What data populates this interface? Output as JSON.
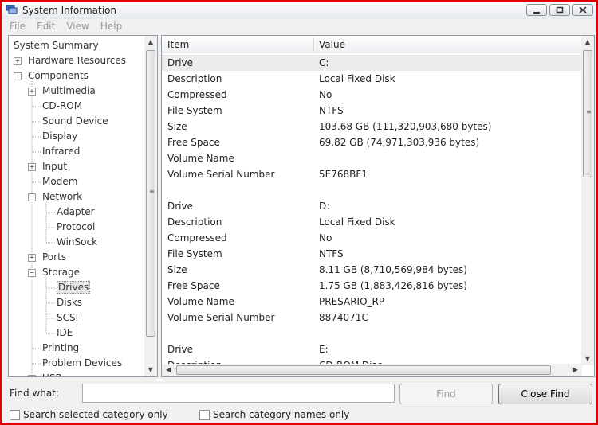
{
  "window": {
    "title": "System Information",
    "icon": "system-information-icon"
  },
  "window_controls": [
    "minimize-icon",
    "restore-icon",
    "close-icon"
  ],
  "menu": [
    "File",
    "Edit",
    "View",
    "Help"
  ],
  "tree": [
    {
      "label": "System Summary",
      "level": 0,
      "expander": "none"
    },
    {
      "label": "Hardware Resources",
      "level": 0,
      "expander": "plus"
    },
    {
      "label": "Components",
      "level": 0,
      "expander": "minus"
    },
    {
      "label": "Multimedia",
      "level": 1,
      "expander": "plus"
    },
    {
      "label": "CD-ROM",
      "level": 1,
      "expander": "none"
    },
    {
      "label": "Sound Device",
      "level": 1,
      "expander": "none"
    },
    {
      "label": "Display",
      "level": 1,
      "expander": "none"
    },
    {
      "label": "Infrared",
      "level": 1,
      "expander": "none"
    },
    {
      "label": "Input",
      "level": 1,
      "expander": "plus"
    },
    {
      "label": "Modem",
      "level": 1,
      "expander": "none"
    },
    {
      "label": "Network",
      "level": 1,
      "expander": "minus"
    },
    {
      "label": "Adapter",
      "level": 2,
      "expander": "none"
    },
    {
      "label": "Protocol",
      "level": 2,
      "expander": "none"
    },
    {
      "label": "WinSock",
      "level": 2,
      "expander": "none"
    },
    {
      "label": "Ports",
      "level": 1,
      "expander": "plus"
    },
    {
      "label": "Storage",
      "level": 1,
      "expander": "minus"
    },
    {
      "label": "Drives",
      "level": 2,
      "expander": "none",
      "selected": true
    },
    {
      "label": "Disks",
      "level": 2,
      "expander": "none"
    },
    {
      "label": "SCSI",
      "level": 2,
      "expander": "none"
    },
    {
      "label": "IDE",
      "level": 2,
      "expander": "none"
    },
    {
      "label": "Printing",
      "level": 1,
      "expander": "none"
    },
    {
      "label": "Problem Devices",
      "level": 1,
      "expander": "none"
    },
    {
      "label": "USB",
      "level": 1,
      "expander": "plus"
    }
  ],
  "columns": {
    "item": "Item",
    "value": "Value"
  },
  "rows": [
    {
      "item": "Drive",
      "value": "C:",
      "selected": true
    },
    {
      "item": "Description",
      "value": "Local Fixed Disk"
    },
    {
      "item": "Compressed",
      "value": "No"
    },
    {
      "item": "File System",
      "value": "NTFS"
    },
    {
      "item": "Size",
      "value": "103.68 GB (111,320,903,680 bytes)"
    },
    {
      "item": "Free Space",
      "value": "69.82 GB (74,971,303,936 bytes)"
    },
    {
      "item": "Volume Name",
      "value": ""
    },
    {
      "item": "Volume Serial Number",
      "value": "5E768BF1"
    },
    {
      "item": "",
      "value": ""
    },
    {
      "item": "Drive",
      "value": "D:"
    },
    {
      "item": "Description",
      "value": "Local Fixed Disk"
    },
    {
      "item": "Compressed",
      "value": "No"
    },
    {
      "item": "File System",
      "value": "NTFS"
    },
    {
      "item": "Size",
      "value": "8.11 GB (8,710,569,984 bytes)"
    },
    {
      "item": "Free Space",
      "value": "1.75 GB (1,883,426,816 bytes)"
    },
    {
      "item": "Volume Name",
      "value": "PRESARIO_RP"
    },
    {
      "item": "Volume Serial Number",
      "value": "8874071C"
    },
    {
      "item": "",
      "value": ""
    },
    {
      "item": "Drive",
      "value": "E:"
    },
    {
      "item": "Description",
      "value": "CD-ROM Disc"
    }
  ],
  "find": {
    "label": "Find what:",
    "value": "",
    "find_button": "Find",
    "close_button": "Close Find",
    "search_selected": "Search selected category only",
    "search_names": "Search category names only"
  }
}
